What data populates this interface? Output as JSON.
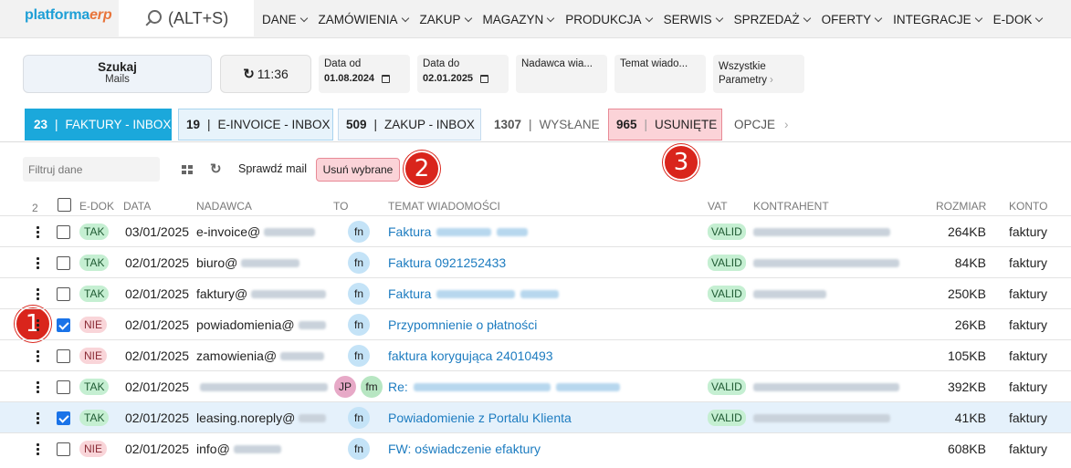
{
  "logo": {
    "platforma": "platforma",
    "erp": "erp"
  },
  "search": {
    "label": "(ALT+S)"
  },
  "nav": [
    "DANE",
    "ZAMÓWIENIA",
    "ZAKUP",
    "MAGAZYN",
    "PRODUKCJA",
    "SERWIS",
    "SPRZEDAŻ",
    "OFERTY",
    "INTEGRACJE",
    "E-DOK"
  ],
  "filters": {
    "search_btn": {
      "title": "Szukaj",
      "sub": "Mails"
    },
    "refresh_time": "11:36",
    "date_from": {
      "label": "Data od",
      "value": "01.08.2024"
    },
    "date_to": {
      "label": "Data do",
      "value": "02.01.2025"
    },
    "sender": {
      "label": "Nadawca wia..."
    },
    "subject": {
      "label": "Temat wiado..."
    },
    "params": {
      "line1": "Wszystkie",
      "line2": "Parametry"
    }
  },
  "tabs": [
    {
      "count": "23",
      "label": "FAKTURY - INBOX"
    },
    {
      "count": "19",
      "label": "E-INVOICE - INBOX"
    },
    {
      "count": "509",
      "label": "ZAKUP - INBOX"
    },
    {
      "count": "1307",
      "label": "WYSŁANE"
    },
    {
      "count": "965",
      "label": "USUNIĘTE"
    },
    {
      "count": "",
      "label": "OPCJE"
    }
  ],
  "toolbar": {
    "filter_placeholder": "Filtruj dane",
    "check_mail": "Sprawdź mail",
    "delete_selected": "Usuń wybrane"
  },
  "badges": [
    "1",
    "2",
    "3"
  ],
  "table": {
    "selected_count": "2",
    "headers": {
      "edok": "E-DOK",
      "data": "DATA",
      "nadawca": "NADAWCA",
      "to": "TO",
      "temat": "TEMAT WIADOMOŚCI",
      "vat": "VAT",
      "kontrahent": "KONTRAHENT",
      "rozmiar": "ROZMIAR",
      "konto": "KONTO"
    },
    "rows": [
      {
        "checked": false,
        "edok": "TAK",
        "date": "03/01/2025",
        "sender": "e-invoice@",
        "to": [
          "fn"
        ],
        "subject": "Faktura",
        "subject_blur": true,
        "vat": "VALID",
        "contractor_blur": true,
        "size": "264KB",
        "account": "faktury",
        "selected": false
      },
      {
        "checked": false,
        "edok": "TAK",
        "date": "02/01/2025",
        "sender": "biuro@",
        "to": [
          "fn"
        ],
        "subject": "Faktura 0921252433",
        "subject_blur": false,
        "vat": "VALID",
        "contractor_blur": true,
        "size": "84KB",
        "account": "faktury",
        "selected": false
      },
      {
        "checked": false,
        "edok": "TAK",
        "date": "02/01/2025",
        "sender": "faktury@",
        "to": [
          "fn"
        ],
        "subject": "Faktura",
        "subject_blur": true,
        "vat": "VALID",
        "contractor_blur": true,
        "size": "250KB",
        "account": "faktury",
        "selected": false
      },
      {
        "checked": true,
        "edok": "NIE",
        "date": "02/01/2025",
        "sender": "powiadomienia@",
        "to": [
          "fn"
        ],
        "subject": "Przypomnienie o płatności",
        "subject_blur": true,
        "vat": "",
        "contractor_blur": false,
        "size": "26KB",
        "account": "faktury",
        "selected": false
      },
      {
        "checked": false,
        "edok": "NIE",
        "date": "02/01/2025",
        "sender": "zamowienia@",
        "to": [
          "fn"
        ],
        "subject": "faktura korygująca 24010493",
        "subject_blur": false,
        "vat": "",
        "contractor_blur": false,
        "size": "105KB",
        "account": "faktury",
        "selected": false
      },
      {
        "checked": false,
        "edok": "TAK",
        "date": "02/01/2025",
        "sender": "",
        "to": [
          "JP",
          "fm"
        ],
        "subject": "Re:",
        "subject_blur": true,
        "vat": "VALID",
        "contractor_blur": true,
        "size": "392KB",
        "account": "faktury",
        "selected": false
      },
      {
        "checked": true,
        "edok": "TAK",
        "date": "02/01/2025",
        "sender": "leasing.noreply@",
        "to": [
          "fn"
        ],
        "subject": "Powiadomienie z Portalu Klienta",
        "subject_blur": false,
        "vat": "VALID",
        "contractor_blur": true,
        "size": "41KB",
        "account": "faktury",
        "selected": true
      },
      {
        "checked": false,
        "edok": "NIE",
        "date": "02/01/2025",
        "sender": "info@",
        "to": [
          "fn"
        ],
        "subject": "FW: oświadczenie efaktury",
        "subject_blur": false,
        "vat": "",
        "contractor_blur": false,
        "size": "608KB",
        "account": "faktury",
        "selected": false
      }
    ]
  }
}
